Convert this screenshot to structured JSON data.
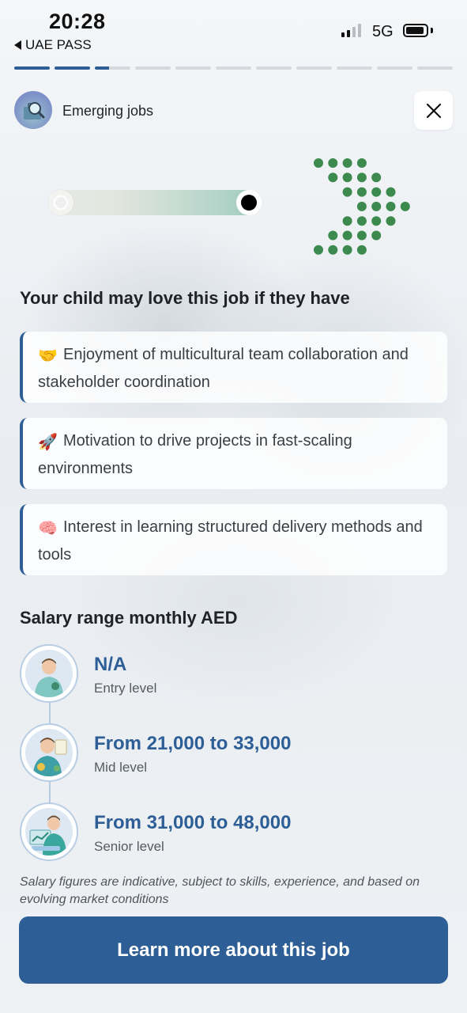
{
  "status_bar": {
    "time": "20:28",
    "back_app": "UAE PASS",
    "network": "5G",
    "battery_level": 0.8,
    "signal_bars": 2
  },
  "progress": {
    "total_steps": 11,
    "current_step": 3,
    "active_color": "#2d5f96"
  },
  "header": {
    "category": "Emerging jobs",
    "close_icon": "close-icon"
  },
  "traits": {
    "title": "Your child may love this job if they have",
    "items": [
      {
        "emoji": "🤝",
        "text": "Enjoyment of multicultural team collaboration and stakeholder coordination"
      },
      {
        "emoji": "🚀",
        "text": "Motivation to drive projects in fast-scaling environments"
      },
      {
        "emoji": "🧠",
        "text": "Interest in learning structured delivery methods and tools"
      }
    ]
  },
  "salary": {
    "title": "Salary range monthly AED",
    "levels": [
      {
        "amount": "N/A",
        "level": "Entry level",
        "icon": "entry-level-avatar-icon"
      },
      {
        "amount": "From 21,000 to 33,000",
        "level": "Mid level",
        "icon": "mid-level-avatar-icon"
      },
      {
        "amount": "From 31,000 to 48,000",
        "level": "Senior level",
        "icon": "senior-level-avatar-icon"
      }
    ],
    "disclaimer": "Salary figures are indicative, subject to skills, experience, and based on evolving market conditions"
  },
  "cta": {
    "label": "Learn more about this job"
  },
  "colors": {
    "primary": "#2d5f96",
    "dots": "#3d8a4e"
  }
}
